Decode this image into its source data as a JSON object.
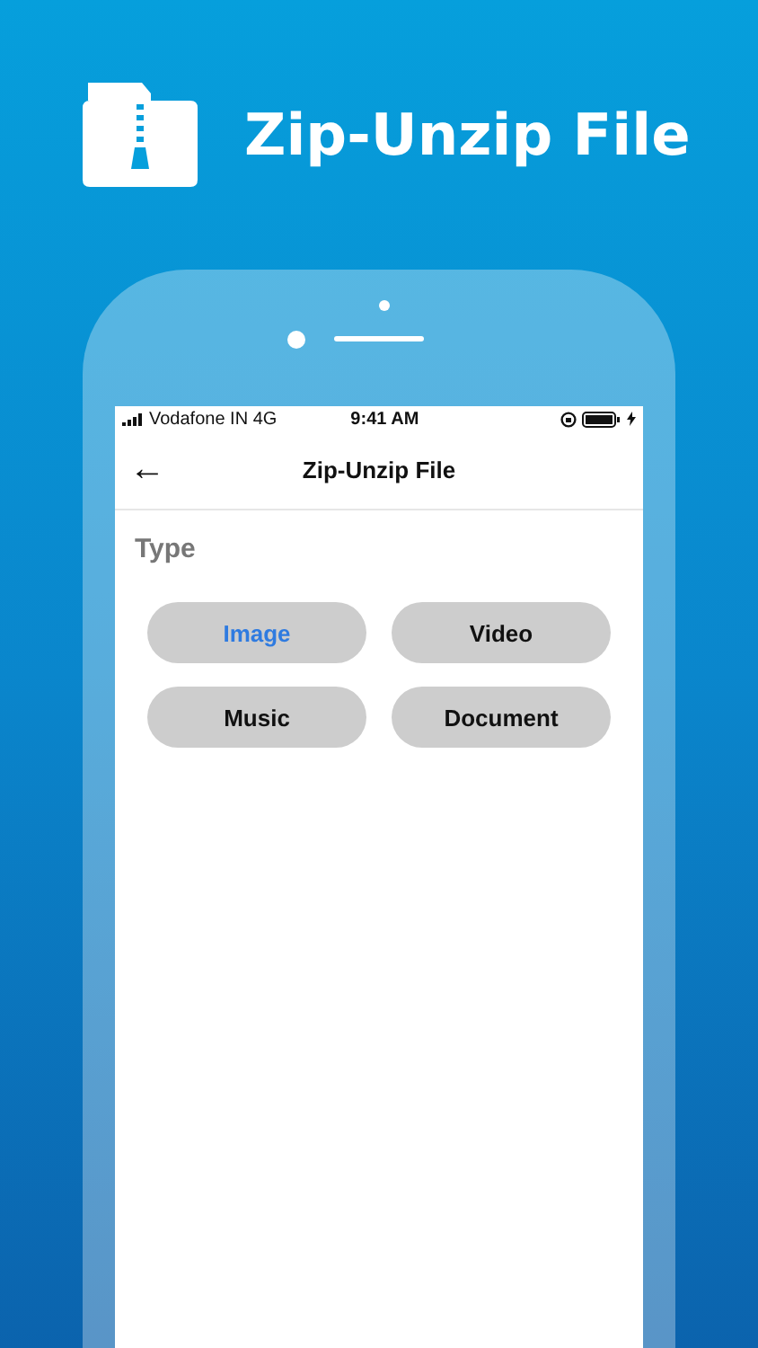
{
  "banner": {
    "title": "Zip-Unzip File"
  },
  "status_bar": {
    "carrier": "Vodafone IN 4G",
    "time": "9:41 AM"
  },
  "nav_bar": {
    "back": "←",
    "title": "Zip-Unzip File"
  },
  "section": {
    "label": "Type"
  },
  "types": [
    {
      "label": "Image",
      "selected": true
    },
    {
      "label": "Video",
      "selected": false
    },
    {
      "label": "Music",
      "selected": false
    },
    {
      "label": "Document",
      "selected": false
    }
  ]
}
